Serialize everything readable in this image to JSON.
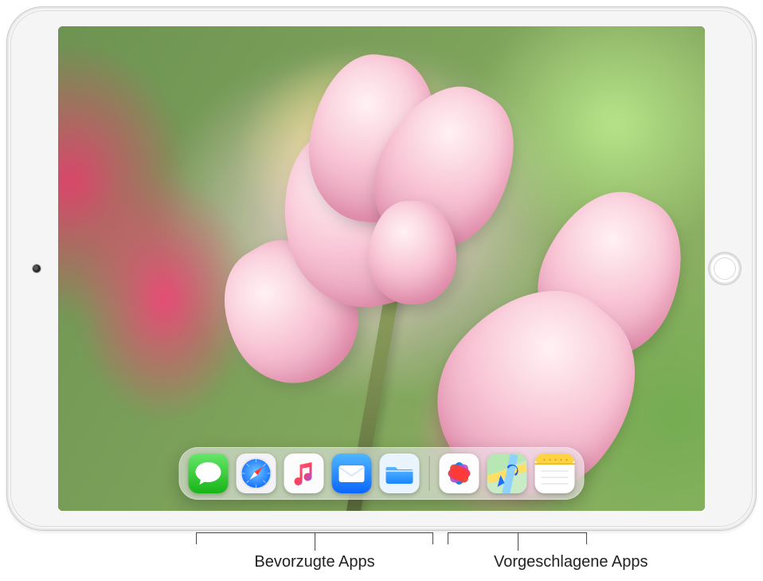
{
  "device": {
    "type": "iPad",
    "orientation": "landscape"
  },
  "dock": {
    "favorites": [
      {
        "id": "messages",
        "name": "Messages"
      },
      {
        "id": "safari",
        "name": "Safari"
      },
      {
        "id": "music",
        "name": "Music"
      },
      {
        "id": "mail",
        "name": "Mail"
      },
      {
        "id": "files",
        "name": "Files"
      }
    ],
    "suggested": [
      {
        "id": "photos",
        "name": "Photos"
      },
      {
        "id": "maps",
        "name": "Maps"
      },
      {
        "id": "notes",
        "name": "Notes"
      }
    ]
  },
  "callouts": {
    "favorites_label": "Bevorzugte Apps",
    "suggested_label": "Vorgeschlagene Apps"
  }
}
